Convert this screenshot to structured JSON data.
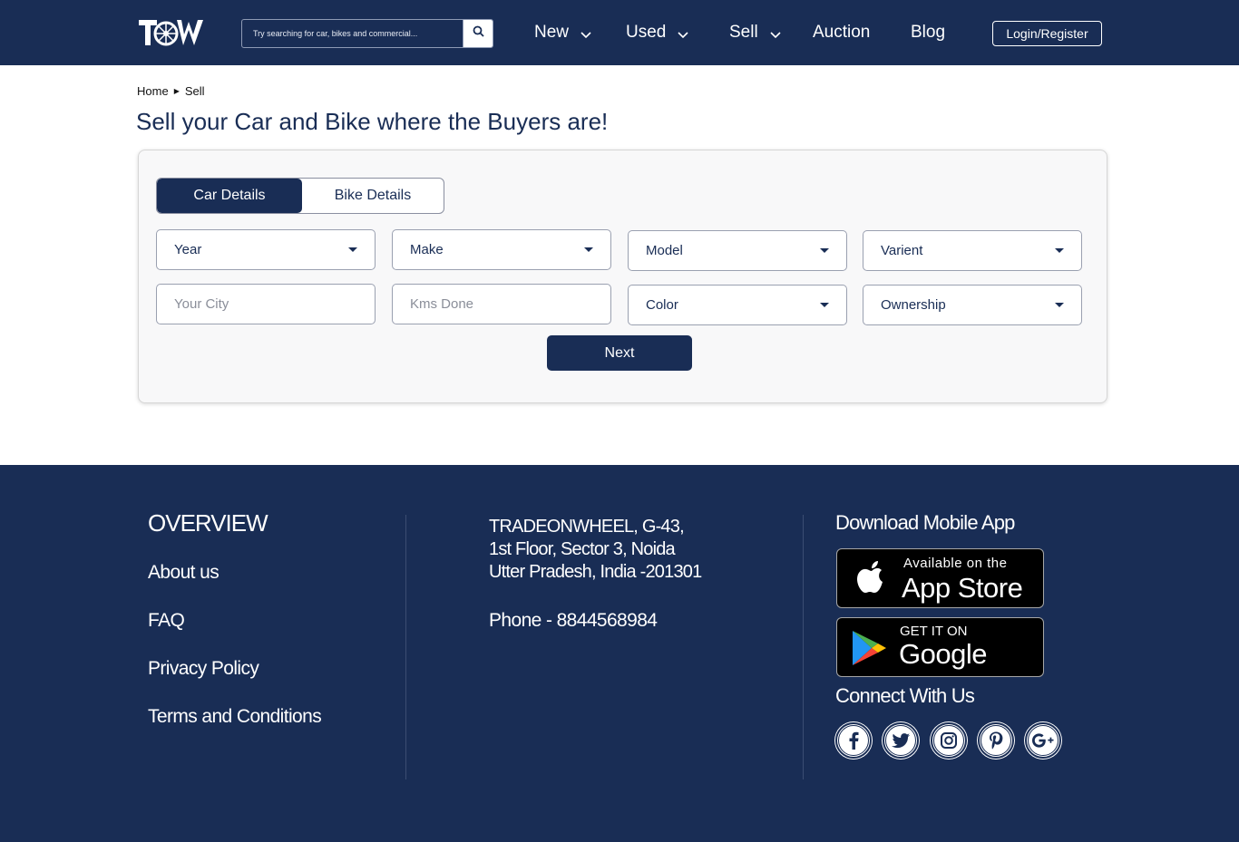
{
  "colors": {
    "primary": "#192d55",
    "white": "#ffffff",
    "card_bg": "#f8f8f9"
  },
  "header": {
    "logo_text": "TOW",
    "search": {
      "placeholder": "Try searching for car, bikes and commercial..."
    },
    "nav": [
      {
        "label": "New",
        "has_dropdown": true
      },
      {
        "label": "Used",
        "has_dropdown": true
      },
      {
        "label": "Sell",
        "has_dropdown": true
      },
      {
        "label": "Auction",
        "has_dropdown": false
      },
      {
        "label": "Blog",
        "has_dropdown": false
      }
    ],
    "login_label": "Login/Register"
  },
  "breadcrumb": {
    "items": [
      "Home",
      "Sell"
    ]
  },
  "page_title": "Sell your Car and Bike where the Buyers are!",
  "form": {
    "tabs": [
      {
        "label": "Car Details",
        "active": true
      },
      {
        "label": "Bike Details",
        "active": false
      }
    ],
    "fields": [
      {
        "label": "Year",
        "type": "select"
      },
      {
        "label": "Make",
        "type": "select"
      },
      {
        "label": "Model",
        "type": "select"
      },
      {
        "label": "Varient",
        "type": "select"
      },
      {
        "label": "Your City",
        "type": "input"
      },
      {
        "label": "Kms Done",
        "type": "input"
      },
      {
        "label": "Color",
        "type": "select"
      },
      {
        "label": "Ownership",
        "type": "select"
      }
    ],
    "next_label": "Next"
  },
  "footer": {
    "overview_title": "OVERVIEW",
    "links": [
      "About us",
      "FAQ",
      "Privacy Policy",
      "Terms and Conditions"
    ],
    "address_lines": [
      "TRADEONWHEEL, G-43,",
      "1st Floor, Sector 3, Noida",
      "Utter Pradesh, India -201301"
    ],
    "phone": "Phone  - 8844568984",
    "download_title": "Download Mobile App",
    "app_store": {
      "small": "Available on the",
      "big": "App Store"
    },
    "google_play": {
      "small": "GET IT ON",
      "big": "Google Play"
    },
    "connect_title": "Connect With Us",
    "social": [
      {
        "icon": "facebook-icon",
        "glyph": "f"
      },
      {
        "icon": "twitter-icon",
        "glyph": ""
      },
      {
        "icon": "instagram-icon",
        "glyph": ""
      },
      {
        "icon": "pinterest-icon",
        "glyph": "P"
      },
      {
        "icon": "google-plus-icon",
        "glyph": "G+"
      }
    ]
  }
}
